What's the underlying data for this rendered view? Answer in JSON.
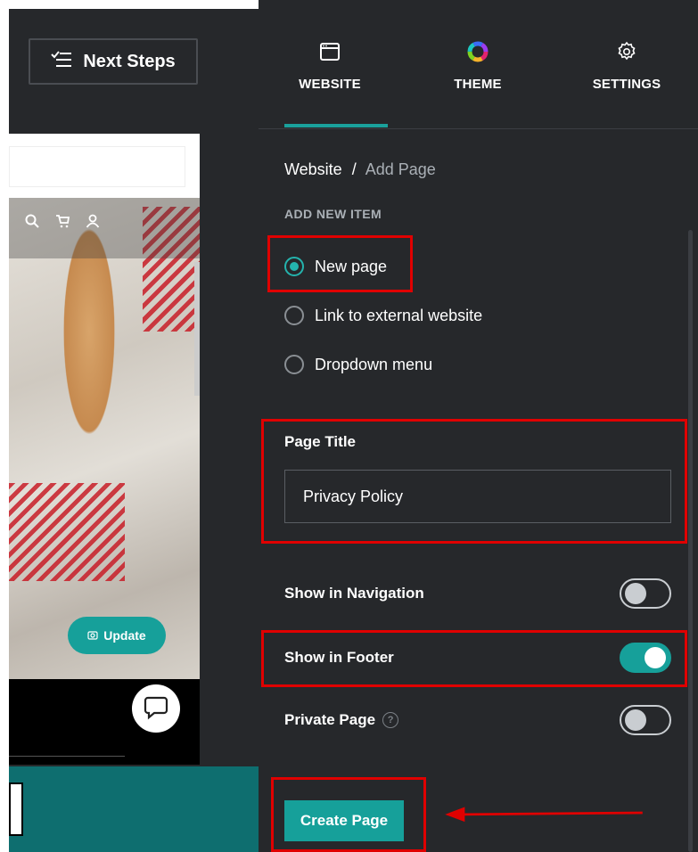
{
  "topbar": {
    "next_steps_label": "Next Steps"
  },
  "preview": {
    "update_label": "Update"
  },
  "tabs": [
    {
      "label": "WEBSITE",
      "icon": "browser-icon",
      "active": true
    },
    {
      "label": "THEME",
      "icon": "color-wheel-icon",
      "active": false
    },
    {
      "label": "SETTINGS",
      "icon": "gear-icon",
      "active": false
    }
  ],
  "breadcrumb": {
    "root": "Website",
    "separator": "/",
    "current": "Add Page"
  },
  "add_new_item": {
    "heading": "ADD NEW ITEM",
    "options": [
      {
        "label": "New page",
        "selected": true
      },
      {
        "label": "Link to external website",
        "selected": false
      },
      {
        "label": "Dropdown menu",
        "selected": false
      }
    ]
  },
  "page_title": {
    "label": "Page Title",
    "value": "Privacy Policy"
  },
  "toggles": {
    "show_in_navigation": {
      "label": "Show in Navigation",
      "on": false
    },
    "show_in_footer": {
      "label": "Show in Footer",
      "on": true
    },
    "private_page": {
      "label": "Private Page",
      "help": "?",
      "on": false
    }
  },
  "create_button_label": "Create Page",
  "colors": {
    "accent": "#16a09a",
    "annotation_red": "#e00000",
    "panel_bg": "#26282b"
  }
}
